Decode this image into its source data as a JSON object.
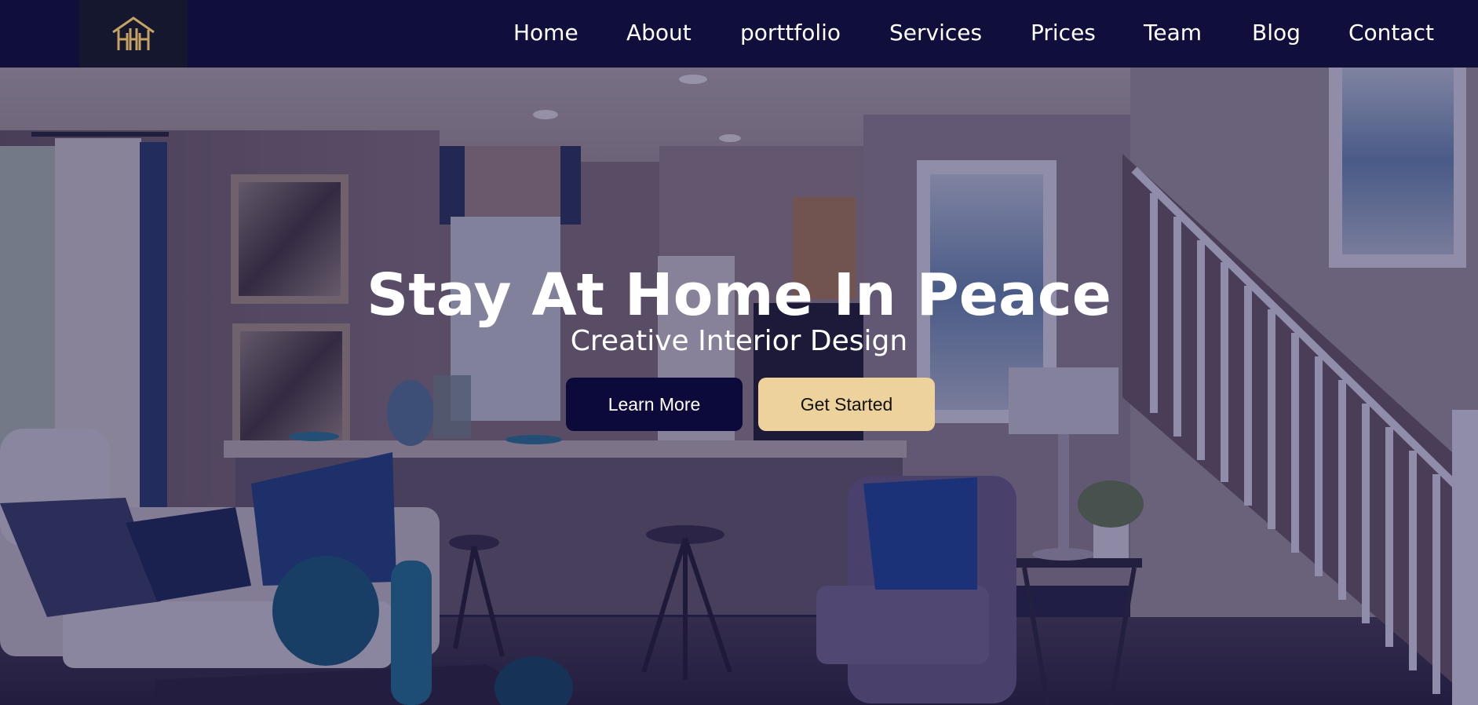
{
  "brand": {
    "logo_icon": "house-monogram-logo-icon",
    "logo_color": "#c6a363"
  },
  "nav": {
    "items": [
      {
        "label": "Home"
      },
      {
        "label": "About"
      },
      {
        "label": "porttfolio"
      },
      {
        "label": "Services"
      },
      {
        "label": "Prices"
      },
      {
        "label": "Team"
      },
      {
        "label": "Blog"
      },
      {
        "label": "Contact"
      }
    ]
  },
  "hero": {
    "background_image": "living-room-interior-photo",
    "title": "Stay At Home In Peace",
    "subtitle": "Creative Interior Design",
    "primary_button": "Learn More",
    "secondary_button": "Get Started"
  },
  "colors": {
    "navbar_bg": "#100f3c",
    "primary_button_bg": "#0b0a3a",
    "secondary_button_bg": "#edd29b",
    "overlay": "#16124e"
  }
}
